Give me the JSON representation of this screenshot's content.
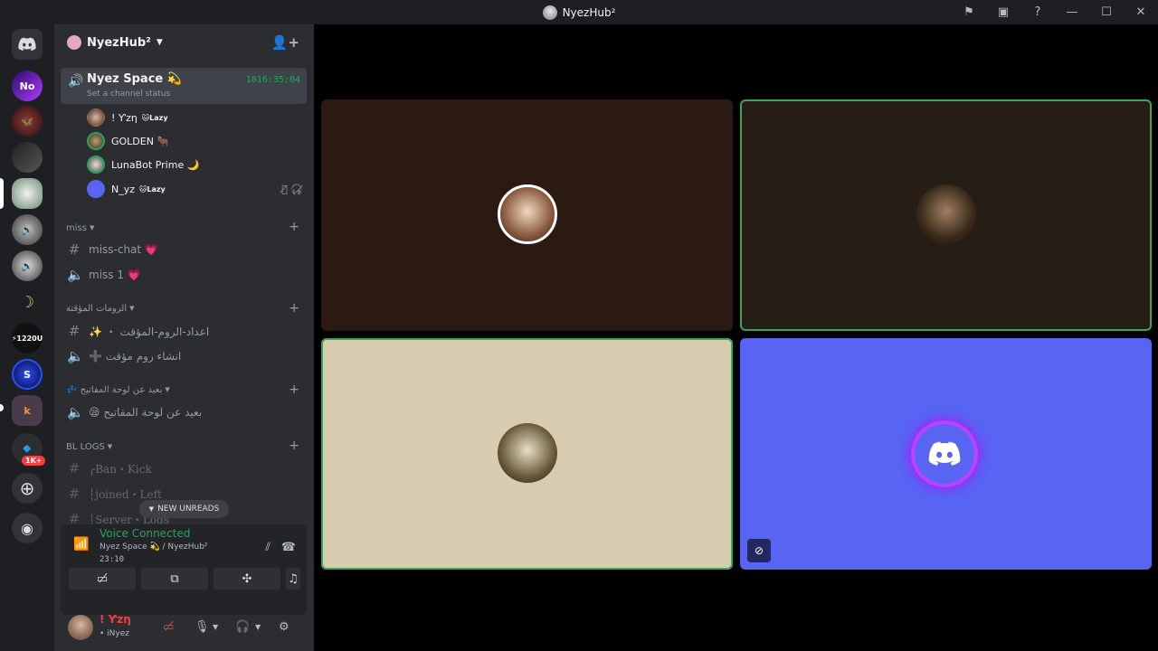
{
  "window": {
    "title": "NyezHub²"
  },
  "server": {
    "name": "NyezHub²"
  },
  "voice_channel": {
    "name": "Nyez Space 💫",
    "status_placeholder": "Set a channel status",
    "timer": "1016:35:04",
    "members": [
      {
        "name": "! Ƴzη",
        "tag": "🐱Lazy",
        "speaking": false
      },
      {
        "name": "GOLDEN 🐂",
        "tag": "",
        "speaking": true
      },
      {
        "name": "LunaBot Prime 🌙",
        "tag": "",
        "speaking": true
      },
      {
        "name": "N_yz",
        "tag": "🐱Lazy",
        "speaking": false
      }
    ]
  },
  "categories": {
    "miss": {
      "label": "miss",
      "channels": [
        "miss-chat 💗",
        "miss 1 💗"
      ]
    },
    "temp": {
      "label": "الرومات المؤقتة",
      "channels": [
        "✨ ・ اعداد-الروم-المؤقت",
        "➕ انشاء روم مؤقت"
      ]
    },
    "afk": {
      "label": "💤 بعيد عن لوحة المفاتيح",
      "channels": [
        "😪 بعيد عن لوحة المفاتيح"
      ]
    },
    "bl_logs": {
      "label": "BL LOGS",
      "channels": [
        "╭Ban・Kick",
        "┆joined・Left",
        "┆Server・Logs"
      ]
    }
  },
  "new_unreads": "NEW UNREADS",
  "voice_panel": {
    "label": "Voice Connected",
    "sub": "Nyez Space 💫 / NyezHub²",
    "time": "23:10"
  },
  "user": {
    "name": "! Ƴzη",
    "status": "• iNyez"
  },
  "guild_badge": "1K+",
  "colors": {
    "accent_green": "#23a55a",
    "blurple": "#5865f2",
    "danger": "#f23f43"
  }
}
